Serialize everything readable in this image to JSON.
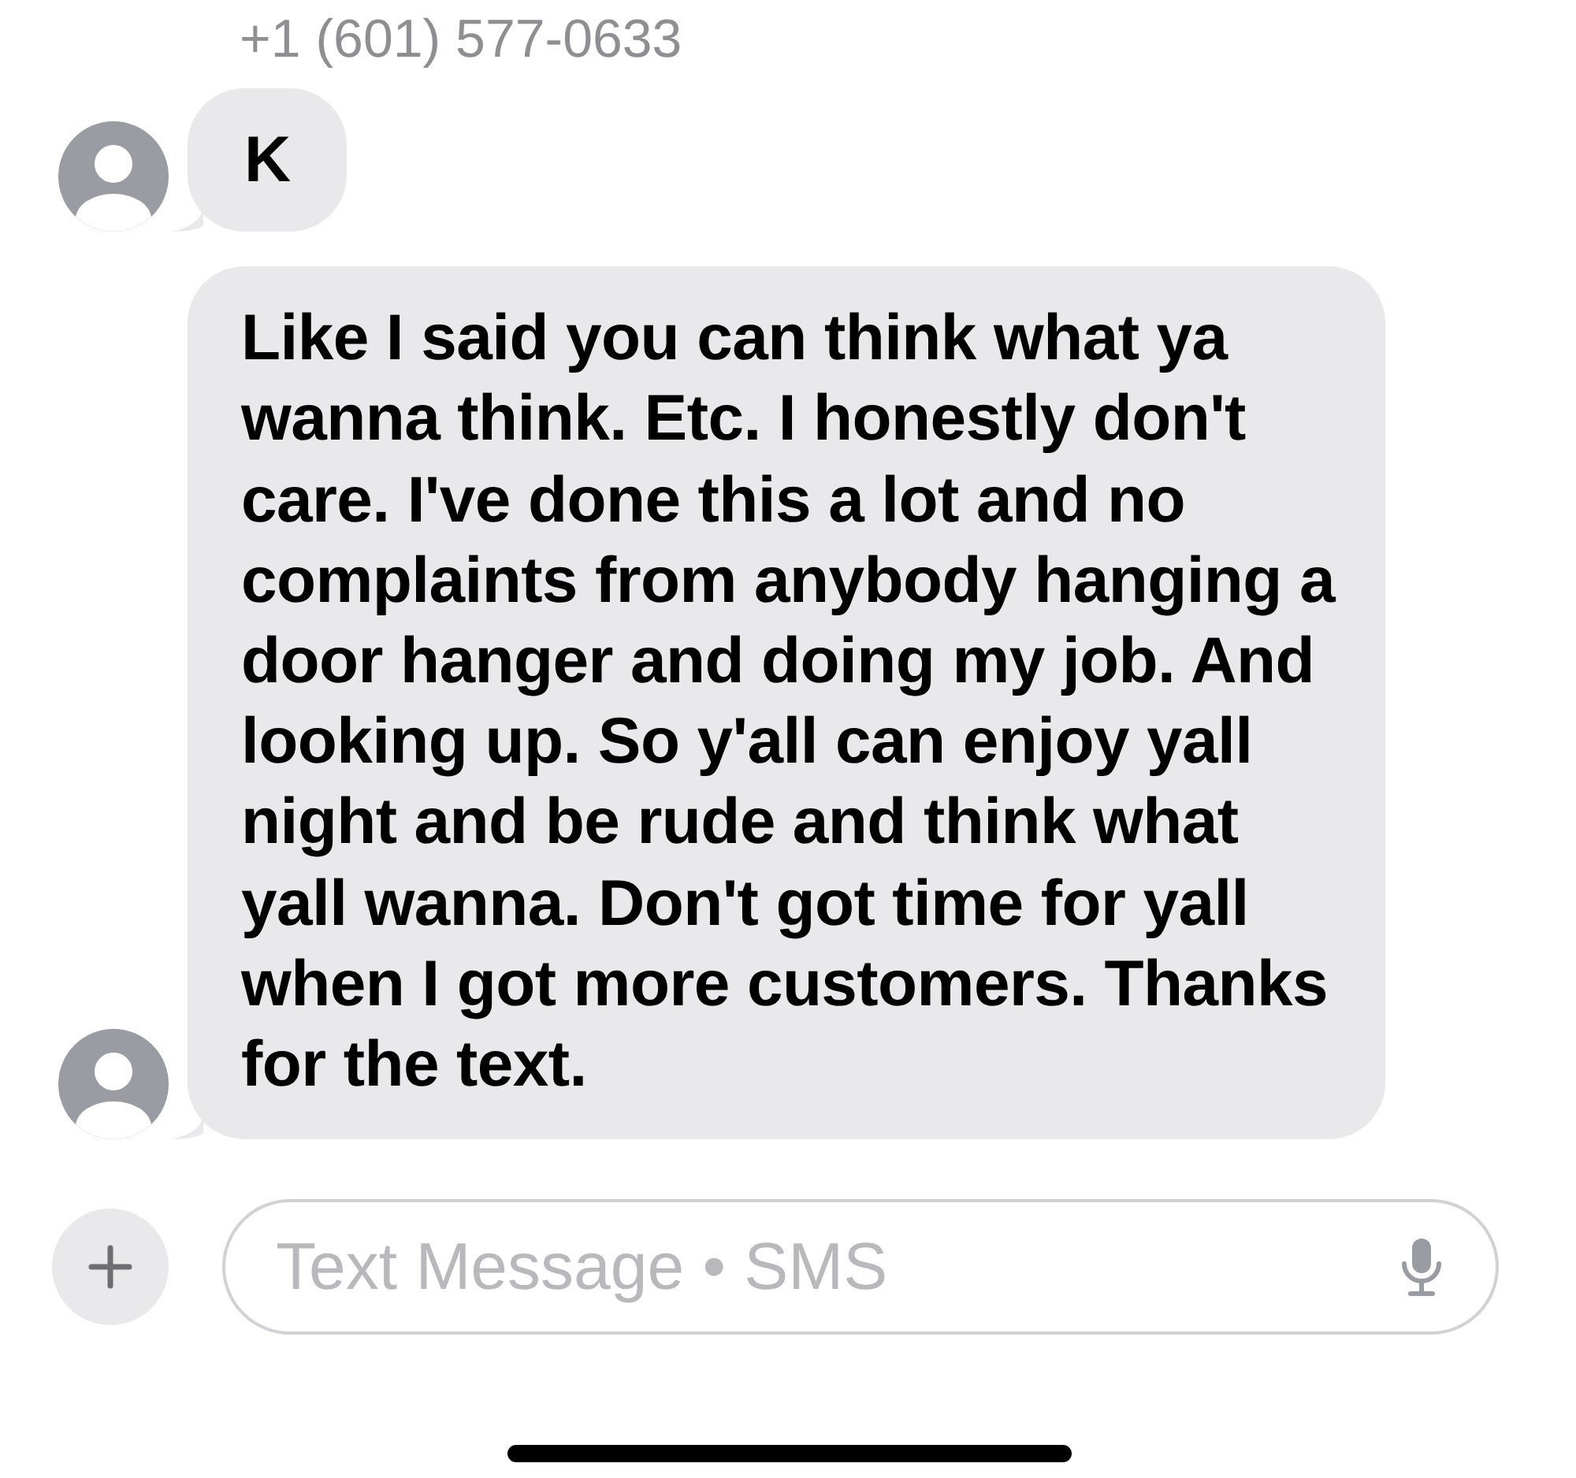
{
  "conversation": {
    "sender": "+1 (601) 577-0633"
  },
  "messages": [
    {
      "text": "K"
    },
    {
      "text": "Like I said you can think what ya wanna think. Etc. I honestly don't care. I've done this a lot and no complaints from anybody hanging a door hanger and doing my job. And looking up. So y'all can enjoy yall night and be rude and think what yall wanna. Don't got time for yall when I got more customers. Thanks for the text."
    }
  ],
  "composer": {
    "placeholder": "Text Message • SMS"
  }
}
